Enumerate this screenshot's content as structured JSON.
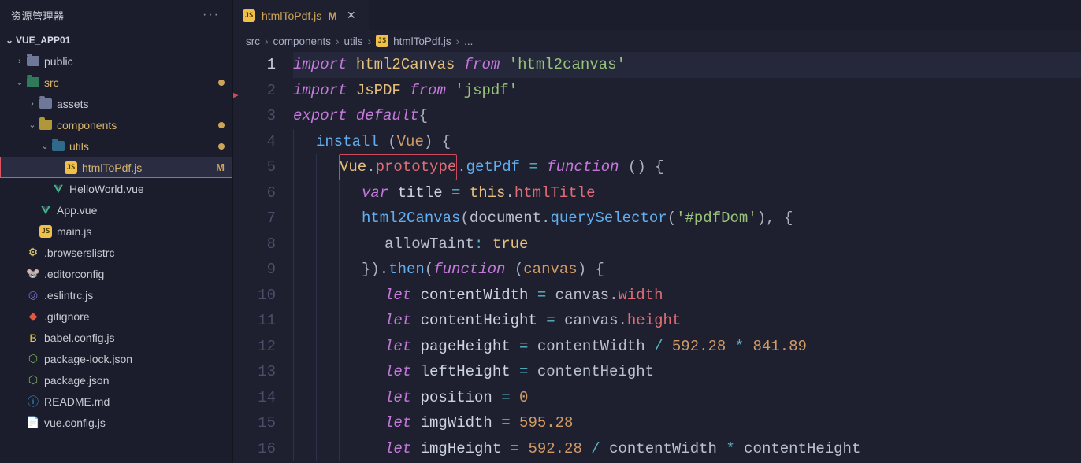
{
  "sidebar": {
    "title": "资源管理器",
    "project": "VUE_APP01",
    "tree": [
      {
        "depth": 0,
        "chev": "right",
        "iconType": "folder",
        "iconClass": "",
        "label": "public",
        "interact": true
      },
      {
        "depth": 0,
        "chev": "down",
        "iconType": "folder",
        "iconClass": "vue",
        "label": "src",
        "interact": true,
        "hasDot": true,
        "modified": true
      },
      {
        "depth": 1,
        "chev": "right",
        "iconType": "folder",
        "iconClass": "",
        "label": "assets",
        "interact": true
      },
      {
        "depth": 1,
        "chev": "down",
        "iconType": "folder",
        "iconClass": "comp",
        "label": "components",
        "interact": true,
        "hasDot": true,
        "modified": true
      },
      {
        "depth": 2,
        "chev": "down",
        "iconType": "folder",
        "iconClass": "utils",
        "label": "utils",
        "interact": true,
        "hasDot": true,
        "modified": true
      },
      {
        "depth": 3,
        "chev": "",
        "iconType": "js",
        "iconClass": "",
        "label": "htmlToPdf.js",
        "interact": true,
        "status": "M",
        "active": true,
        "modified": true
      },
      {
        "depth": 2,
        "chev": "",
        "iconType": "vue",
        "iconClass": "",
        "label": "HelloWorld.vue",
        "interact": true
      },
      {
        "depth": 1,
        "chev": "",
        "iconType": "vue",
        "iconClass": "",
        "label": "App.vue",
        "interact": true
      },
      {
        "depth": 1,
        "chev": "",
        "iconType": "js",
        "iconClass": "",
        "label": "main.js",
        "interact": true
      },
      {
        "depth": 0,
        "chev": "",
        "iconType": "glyph",
        "glyph": "⚙",
        "glyphColor": "#d6c26b",
        "label": ".browserslistrc",
        "interact": true
      },
      {
        "depth": 0,
        "chev": "",
        "iconType": "glyph",
        "glyph": "🐭",
        "glyphColor": "#bbb",
        "label": ".editorconfig",
        "interact": true
      },
      {
        "depth": 0,
        "chev": "",
        "iconType": "glyph",
        "glyph": "◎",
        "glyphColor": "#7a6fd1",
        "label": ".eslintrc.js",
        "interact": true
      },
      {
        "depth": 0,
        "chev": "",
        "iconType": "glyph",
        "glyph": "◆",
        "glyphColor": "#e0593f",
        "label": ".gitignore",
        "interact": true
      },
      {
        "depth": 0,
        "chev": "",
        "iconType": "glyph",
        "glyph": "B",
        "glyphColor": "#efc94c",
        "label": "babel.config.js",
        "interact": true
      },
      {
        "depth": 0,
        "chev": "",
        "iconType": "glyph",
        "glyph": "⬡",
        "glyphColor": "#7fae5c",
        "label": "package-lock.json",
        "interact": true
      },
      {
        "depth": 0,
        "chev": "",
        "iconType": "glyph",
        "glyph": "⬡",
        "glyphColor": "#7fae5c",
        "label": "package.json",
        "interact": true
      },
      {
        "depth": 0,
        "chev": "",
        "iconType": "glyph",
        "glyph": "ⓘ",
        "glyphColor": "#3b9dd8",
        "label": "README.md",
        "interact": true
      },
      {
        "depth": 0,
        "chev": "",
        "iconType": "glyph",
        "glyph": "📄",
        "glyphColor": "#8aa",
        "label": "vue.config.js",
        "interact": true
      }
    ]
  },
  "tab": {
    "icon": "js",
    "label": "htmlToPdf.js",
    "modified": "M"
  },
  "breadcrumbs": {
    "parts": [
      {
        "text": "src",
        "icon": null
      },
      {
        "text": "components",
        "icon": null
      },
      {
        "text": "utils",
        "icon": null
      },
      {
        "text": "htmlToPdf.js",
        "icon": "js"
      },
      {
        "text": "...",
        "icon": null
      }
    ]
  },
  "code": {
    "current_line": 1,
    "lines": [
      {
        "n": 1,
        "hl": true,
        "tokens": [
          [
            "k",
            "import "
          ],
          [
            "ty",
            "html2Canvas "
          ],
          [
            "k",
            "from "
          ],
          [
            "s",
            "'html2canvas'"
          ]
        ]
      },
      {
        "n": 2,
        "tokens": [
          [
            "k",
            "import "
          ],
          [
            "ty",
            "JsPDF "
          ],
          [
            "k",
            "from "
          ],
          [
            "s",
            "'jspdf'"
          ]
        ]
      },
      {
        "n": 3,
        "tokens": [
          [
            "k",
            "export "
          ],
          [
            "k",
            "default"
          ],
          [
            "p",
            "{"
          ]
        ]
      },
      {
        "n": 4,
        "indent": 1,
        "tokens": [
          [
            "fn",
            "install"
          ],
          [
            "p",
            " ("
          ],
          [
            "attr",
            "Vue"
          ],
          [
            "p",
            ") "
          ],
          [
            "p",
            "{"
          ]
        ]
      },
      {
        "n": 5,
        "indent": 2,
        "tokens": [
          [
            "redbox_start",
            ""
          ],
          [
            "ty",
            "Vue"
          ],
          [
            "p",
            "."
          ],
          [
            "pr",
            "prototype"
          ],
          [
            "redbox_end",
            ""
          ],
          [
            "p",
            "."
          ],
          [
            "fn",
            "getPdf"
          ],
          [
            "p",
            " "
          ],
          [
            "op",
            "="
          ],
          [
            "p",
            " "
          ],
          [
            "k",
            "function"
          ],
          [
            "p",
            " () "
          ],
          [
            "p",
            "{"
          ]
        ]
      },
      {
        "n": 6,
        "indent": 3,
        "tokens": [
          [
            "k",
            "var "
          ],
          [
            "wht",
            "title "
          ],
          [
            "op",
            "="
          ],
          [
            "p",
            " "
          ],
          [
            "th",
            "this"
          ],
          [
            "p",
            "."
          ],
          [
            "pr",
            "htmlTitle"
          ]
        ]
      },
      {
        "n": 7,
        "indent": 3,
        "tokens": [
          [
            "fn",
            "html2Canvas"
          ],
          [
            "p",
            "("
          ],
          [
            "id",
            "document"
          ],
          [
            "p",
            "."
          ],
          [
            "fn",
            "querySelector"
          ],
          [
            "p",
            "("
          ],
          [
            "s",
            "'#pdfDom'"
          ],
          [
            "p",
            "), "
          ],
          [
            "p",
            "{"
          ]
        ]
      },
      {
        "n": 8,
        "indent": 4,
        "tokens": [
          [
            "id",
            "allowTaint"
          ],
          [
            "op",
            ":"
          ],
          [
            "p",
            " "
          ],
          [
            "th",
            "true"
          ]
        ]
      },
      {
        "n": 9,
        "indent": 3,
        "tokens": [
          [
            "p",
            "})."
          ],
          [
            "fn",
            "then"
          ],
          [
            "p",
            "("
          ],
          [
            "k",
            "function"
          ],
          [
            "p",
            " ("
          ],
          [
            "attr",
            "canvas"
          ],
          [
            "p",
            ") "
          ],
          [
            "p",
            "{"
          ]
        ]
      },
      {
        "n": 10,
        "indent": 4,
        "tokens": [
          [
            "k",
            "let "
          ],
          [
            "wht",
            "contentWidth "
          ],
          [
            "op",
            "="
          ],
          [
            "p",
            " "
          ],
          [
            "id",
            "canvas"
          ],
          [
            "p",
            "."
          ],
          [
            "pr",
            "width"
          ]
        ]
      },
      {
        "n": 11,
        "indent": 4,
        "tokens": [
          [
            "k",
            "let "
          ],
          [
            "wht",
            "contentHeight "
          ],
          [
            "op",
            "="
          ],
          [
            "p",
            " "
          ],
          [
            "id",
            "canvas"
          ],
          [
            "p",
            "."
          ],
          [
            "pr",
            "height"
          ]
        ]
      },
      {
        "n": 12,
        "indent": 4,
        "tokens": [
          [
            "k",
            "let "
          ],
          [
            "wht",
            "pageHeight "
          ],
          [
            "op",
            "="
          ],
          [
            "p",
            " "
          ],
          [
            "id",
            "contentWidth "
          ],
          [
            "op",
            "/"
          ],
          [
            "p",
            " "
          ],
          [
            "n",
            "592.28"
          ],
          [
            "p",
            " "
          ],
          [
            "op",
            "*"
          ],
          [
            "p",
            " "
          ],
          [
            "n",
            "841.89"
          ]
        ]
      },
      {
        "n": 13,
        "indent": 4,
        "tokens": [
          [
            "k",
            "let "
          ],
          [
            "wht",
            "leftHeight "
          ],
          [
            "op",
            "="
          ],
          [
            "p",
            " "
          ],
          [
            "id",
            "contentHeight"
          ]
        ]
      },
      {
        "n": 14,
        "indent": 4,
        "tokens": [
          [
            "k",
            "let "
          ],
          [
            "wht",
            "position "
          ],
          [
            "op",
            "="
          ],
          [
            "p",
            " "
          ],
          [
            "n",
            "0"
          ]
        ]
      },
      {
        "n": 15,
        "indent": 4,
        "tokens": [
          [
            "k",
            "let "
          ],
          [
            "wht",
            "imgWidth "
          ],
          [
            "op",
            "="
          ],
          [
            "p",
            " "
          ],
          [
            "n",
            "595.28"
          ]
        ]
      },
      {
        "n": 16,
        "indent": 4,
        "tokens": [
          [
            "k",
            "let "
          ],
          [
            "wht",
            "imgHeight "
          ],
          [
            "op",
            "="
          ],
          [
            "p",
            " "
          ],
          [
            "n",
            "592.28"
          ],
          [
            "p",
            " "
          ],
          [
            "op",
            "/"
          ],
          [
            "p",
            " "
          ],
          [
            "id",
            "contentWidth "
          ],
          [
            "op",
            "*"
          ],
          [
            "p",
            " "
          ],
          [
            "id",
            "contentHeight"
          ]
        ]
      }
    ]
  }
}
